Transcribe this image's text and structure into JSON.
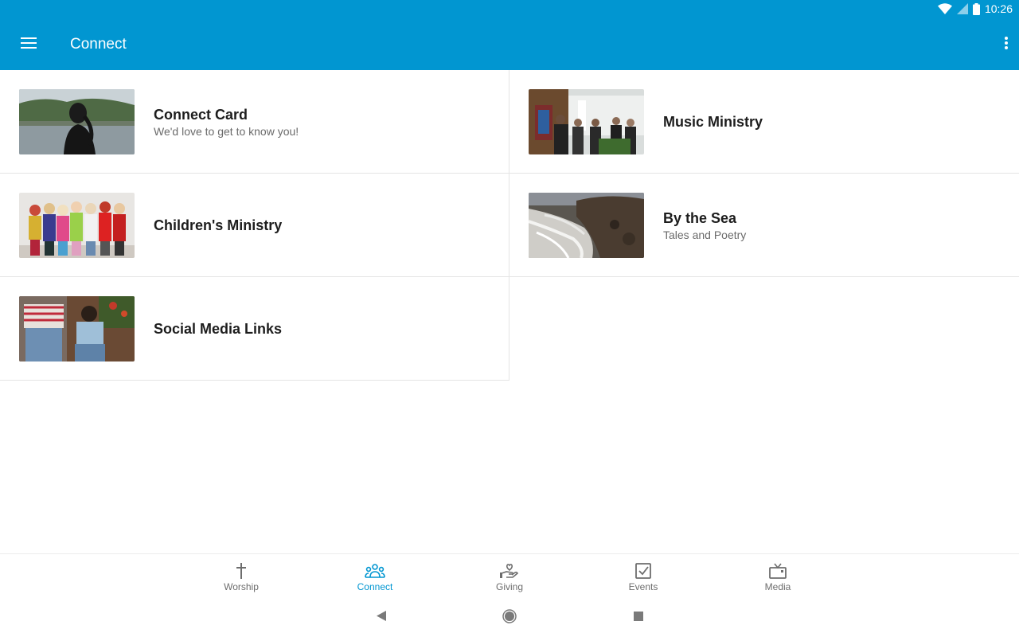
{
  "status_bar": {
    "time": "10:26",
    "icons": [
      "wifi-icon",
      "signal-icon",
      "battery-icon"
    ]
  },
  "app_bar": {
    "title": "Connect",
    "menu_icon": "hamburger-menu-icon",
    "overflow_icon": "more-vert-icon"
  },
  "items": [
    {
      "title": "Connect Card",
      "subtitle": "We'd love to get to know you!",
      "image": "connect-card-image"
    },
    {
      "title": "Music Ministry",
      "subtitle": "",
      "image": "music-ministry-image"
    },
    {
      "title": "Children's Ministry",
      "subtitle": "",
      "image": "childrens-ministry-image"
    },
    {
      "title": "By the Sea",
      "subtitle": "Tales and Poetry",
      "image": "by-the-sea-image"
    },
    {
      "title": "Social Media Links",
      "subtitle": "",
      "image": "social-media-image"
    }
  ],
  "bottom_nav": {
    "active": "Connect",
    "tabs": [
      {
        "label": "Worship",
        "icon": "cross-icon"
      },
      {
        "label": "Connect",
        "icon": "people-icon"
      },
      {
        "label": "Giving",
        "icon": "giving-hand-icon"
      },
      {
        "label": "Events",
        "icon": "checkbox-icon"
      },
      {
        "label": "Media",
        "icon": "tv-icon"
      }
    ]
  },
  "system_nav": {
    "buttons": [
      "back-icon",
      "home-icon",
      "recents-icon"
    ]
  },
  "colors": {
    "primary": "#0196d1",
    "divider": "#e4e4e4",
    "title_text": "#1d1d1d",
    "subtitle_text": "#6a6a6a",
    "inactive_nav": "#6d6d6d"
  }
}
